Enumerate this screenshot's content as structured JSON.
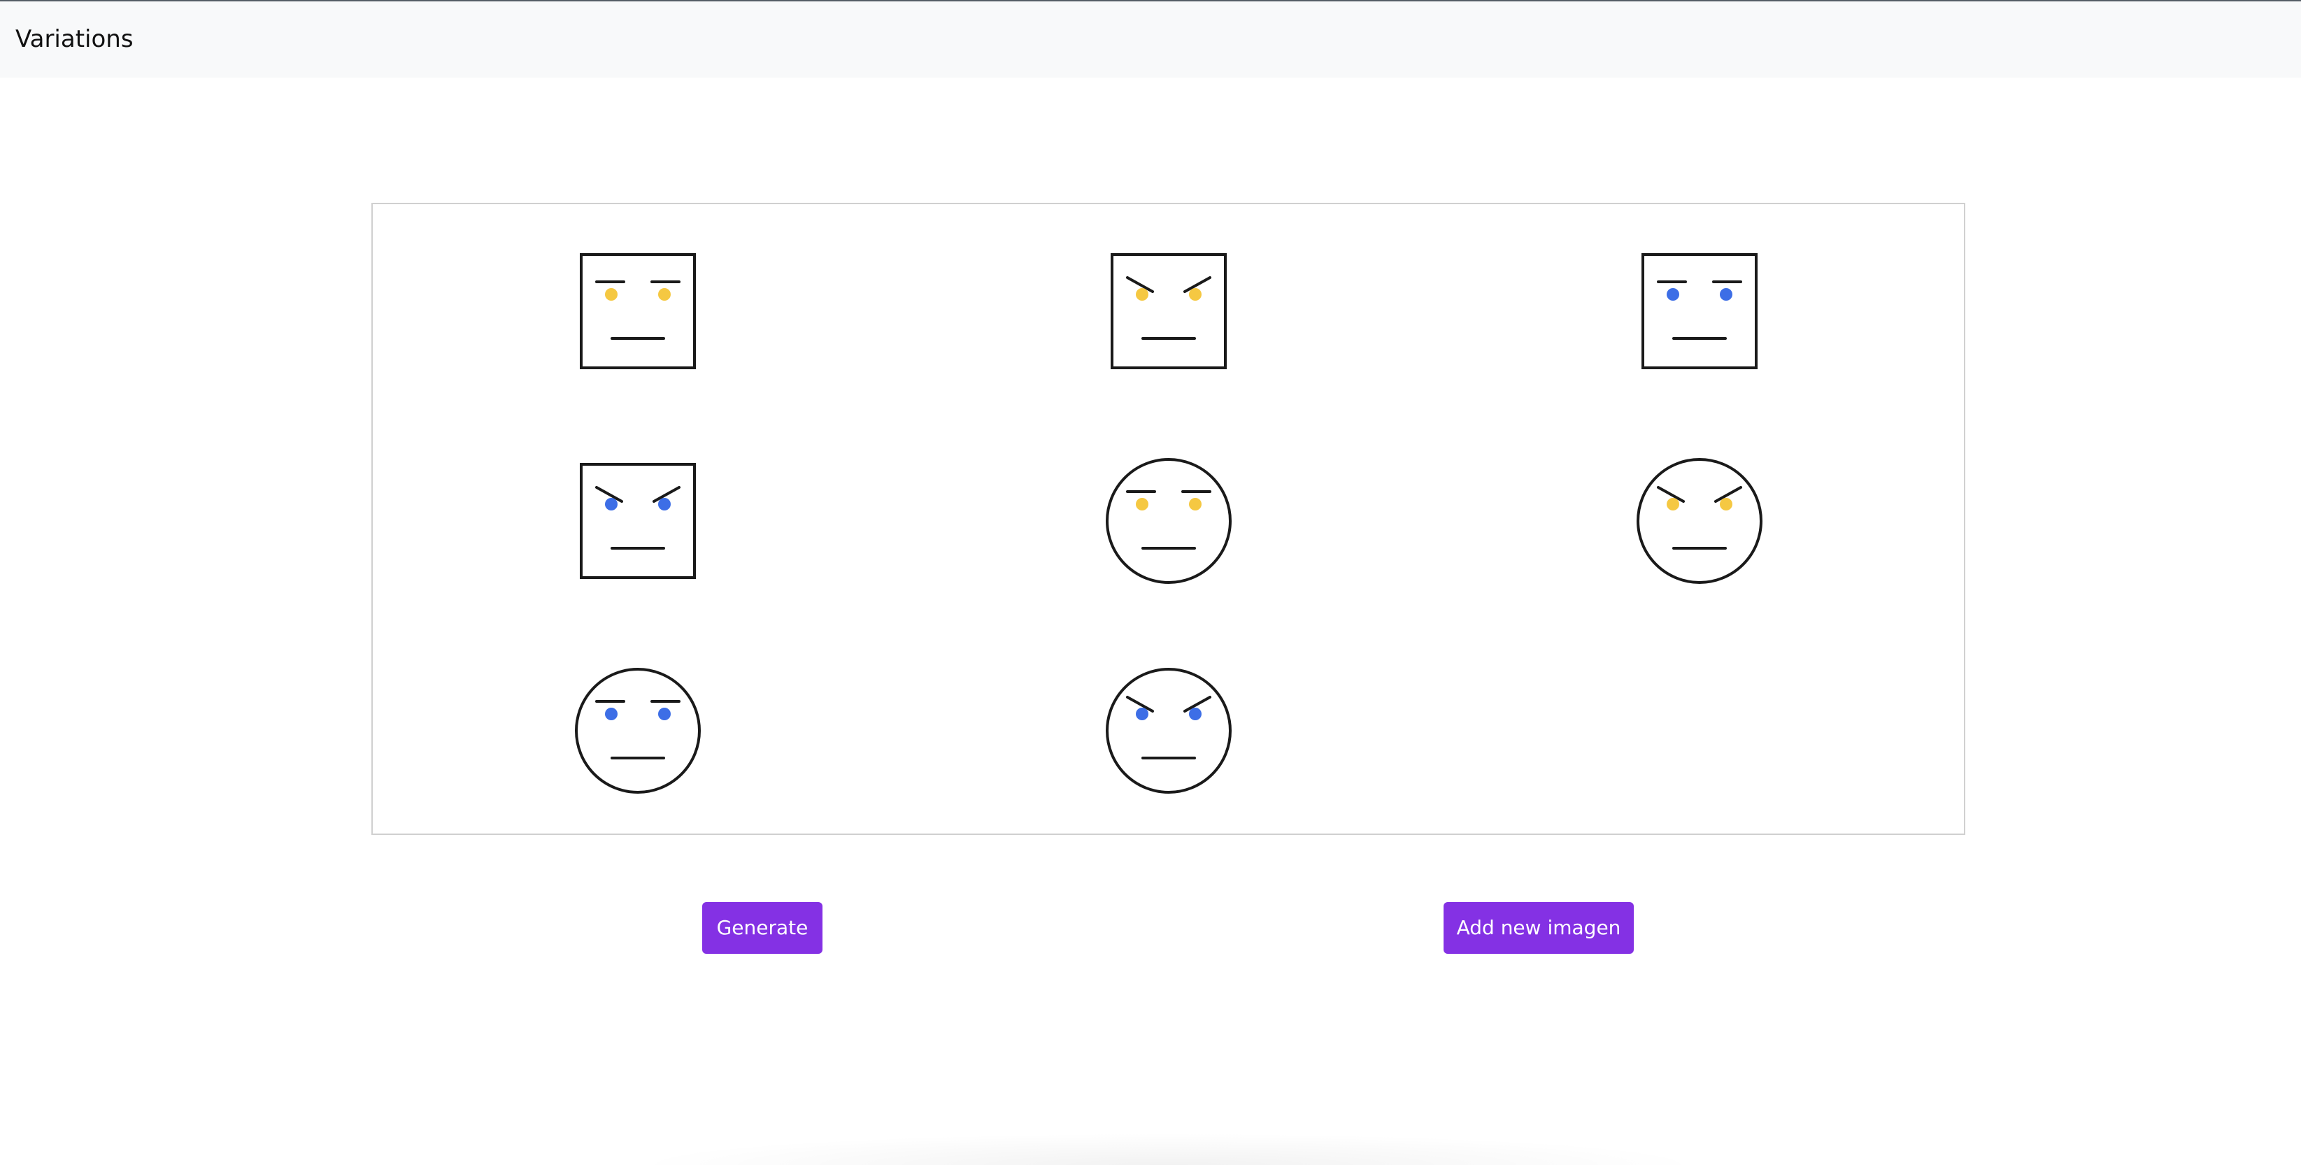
{
  "header": {
    "title": "Variations"
  },
  "gallery": {
    "faces": [
      {
        "shape": "square",
        "eyebrows": "neutral",
        "eye_color": "#f5c842"
      },
      {
        "shape": "square",
        "eyebrows": "angry",
        "eye_color": "#f5c842"
      },
      {
        "shape": "square",
        "eyebrows": "neutral",
        "eye_color": "#3d6ee6"
      },
      {
        "shape": "square",
        "eyebrows": "angry",
        "eye_color": "#3d6ee6"
      },
      {
        "shape": "circle",
        "eyebrows": "neutral",
        "eye_color": "#f5c842"
      },
      {
        "shape": "circle",
        "eyebrows": "angry",
        "eye_color": "#f5c842"
      },
      {
        "shape": "circle",
        "eyebrows": "neutral",
        "eye_color": "#3d6ee6"
      },
      {
        "shape": "circle",
        "eyebrows": "angry",
        "eye_color": "#3d6ee6"
      }
    ]
  },
  "actions": {
    "generate_label": "Generate",
    "add_label": "Add new imagen"
  },
  "colors": {
    "button": "#8431e4",
    "yellow_eye": "#f5c842",
    "blue_eye": "#3d6ee6",
    "stroke": "#1a1a1a"
  }
}
